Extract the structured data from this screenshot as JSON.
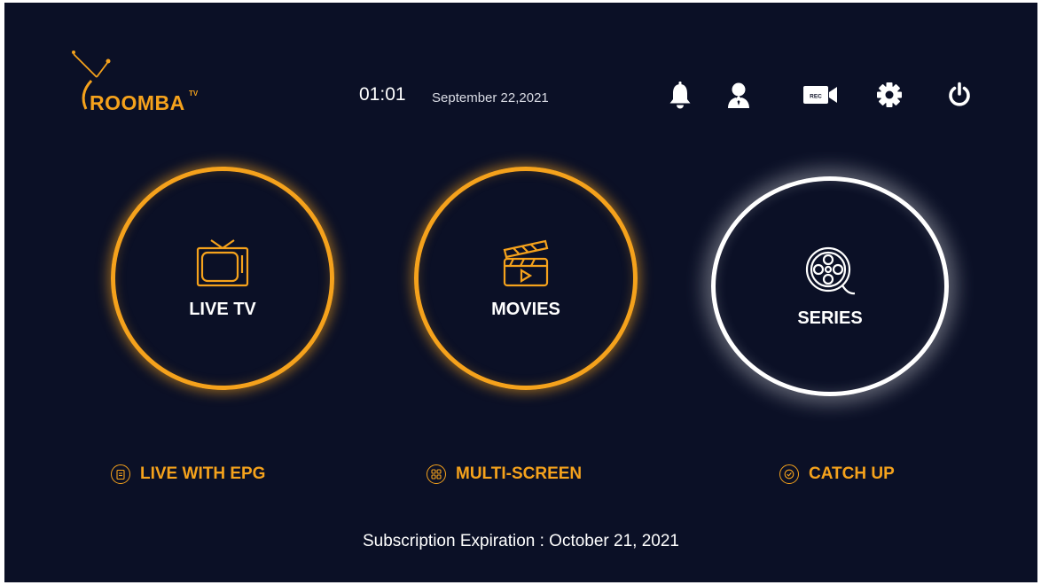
{
  "brand": {
    "name": "ROOMBA",
    "superscript": "TV",
    "accent": "#f5a21c"
  },
  "clock": {
    "time": "01:01",
    "date": "September 22,2021"
  },
  "top_icons": [
    "bell-icon",
    "user-icon",
    "record-icon",
    "gear-icon",
    "power-icon"
  ],
  "record_icon_text": "REC",
  "tiles": [
    {
      "label": "LIVE TV",
      "icon": "tv-icon",
      "state": "normal"
    },
    {
      "label": "MOVIES",
      "icon": "clapperboard-icon",
      "state": "normal"
    },
    {
      "label": "SERIES",
      "icon": "film-reel-icon",
      "state": "focused"
    }
  ],
  "menu": [
    {
      "label": "LIVE WITH EPG",
      "icon": "clipboard-icon"
    },
    {
      "label": "MULTI-SCREEN",
      "icon": "grid-icon"
    },
    {
      "label": "CATCH UP",
      "icon": "check-circle-icon"
    }
  ],
  "subscription": "Subscription Expiration : October 21, 2021"
}
